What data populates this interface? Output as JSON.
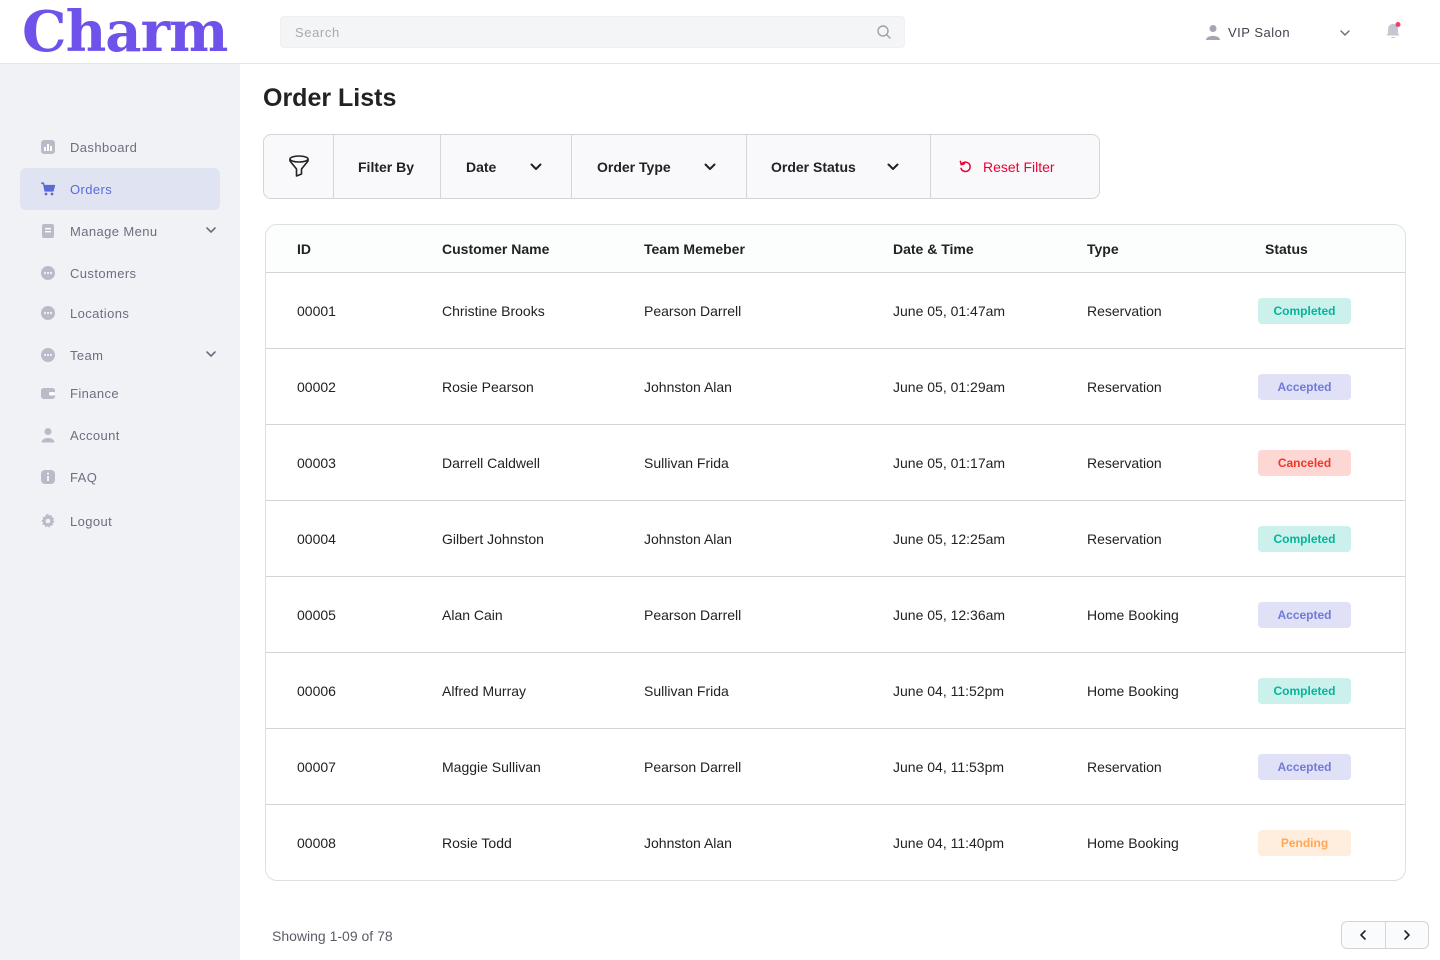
{
  "brand": {
    "logo_text": "Charm",
    "accent": "#6f52ea"
  },
  "search": {
    "placeholder": "Search",
    "value": ""
  },
  "user": {
    "name": "VIP Salon"
  },
  "sidebar": {
    "items": [
      {
        "label": "Dashboard",
        "icon": "bar-chart-icon",
        "active": false,
        "expandable": false
      },
      {
        "label": "Orders",
        "icon": "cart-icon",
        "active": true,
        "expandable": false
      },
      {
        "label": "Manage Menu",
        "icon": "document-icon",
        "active": false,
        "expandable": true
      },
      {
        "label": "Customers",
        "icon": "chat-bubble-icon",
        "active": false,
        "expandable": false
      },
      {
        "label": "Locations",
        "icon": "chat-bubble-icon",
        "active": false,
        "expandable": false
      },
      {
        "label": "Team",
        "icon": "chat-bubble-icon",
        "active": false,
        "expandable": true
      },
      {
        "label": "Finance",
        "icon": "wallet-icon",
        "active": false,
        "expandable": false
      },
      {
        "label": "Account",
        "icon": "person-icon",
        "active": false,
        "expandable": false
      },
      {
        "label": "FAQ",
        "icon": "info-icon",
        "active": false,
        "expandable": false
      },
      {
        "label": "Logout",
        "icon": "gear-icon",
        "active": false,
        "expandable": false
      }
    ]
  },
  "page": {
    "title": "Order Lists"
  },
  "filters": {
    "filter_by": "Filter By",
    "date": "Date",
    "order_type": "Order Type",
    "order_status": "Order Status",
    "reset": "Reset Filter"
  },
  "table": {
    "headers": {
      "id": "ID",
      "customer": "Customer Name",
      "team": "Team Memeber",
      "date": "Date & Time",
      "type": "Type",
      "status": "Status"
    },
    "rows": [
      {
        "id": "00001",
        "customer": "Christine Brooks",
        "team": "Pearson Darrell",
        "date": "June 05, 01:47am",
        "type": "Reservation",
        "status": "Completed"
      },
      {
        "id": "00002",
        "customer": "Rosie Pearson",
        "team": "Johnston Alan",
        "date": "June 05, 01:29am",
        "type": "Reservation",
        "status": "Accepted"
      },
      {
        "id": "00003",
        "customer": "Darrell Caldwell",
        "team": "Sullivan Frida",
        "date": "June 05, 01:17am",
        "type": "Reservation",
        "status": "Canceled"
      },
      {
        "id": "00004",
        "customer": "Gilbert Johnston",
        "team": "Johnston Alan",
        "date": "June 05, 12:25am",
        "type": "Reservation",
        "status": "Completed"
      },
      {
        "id": "00005",
        "customer": "Alan Cain",
        "team": "Pearson Darrell",
        "date": "June 05, 12:36am",
        "type": "Home Booking",
        "status": "Accepted"
      },
      {
        "id": "00006",
        "customer": "Alfred Murray",
        "team": "Sullivan Frida",
        "date": "June 04, 11:52pm",
        "type": "Home Booking",
        "status": "Completed"
      },
      {
        "id": "00007",
        "customer": "Maggie Sullivan",
        "team": "Pearson Darrell",
        "date": "June 04, 11:53pm",
        "type": "Reservation",
        "status": "Accepted"
      },
      {
        "id": "00008",
        "customer": "Rosie Todd",
        "team": "Johnston Alan",
        "date": "June 04, 11:40pm",
        "type": "Home Booking",
        "status": "Pending"
      }
    ]
  },
  "pagination": {
    "summary": "Showing 1-09 of 78"
  },
  "status_colors": {
    "Completed": "#00b69b",
    "Accepted": "#6f7ad9",
    "Canceled": "#ef3826",
    "Pending": "#ffa756"
  }
}
